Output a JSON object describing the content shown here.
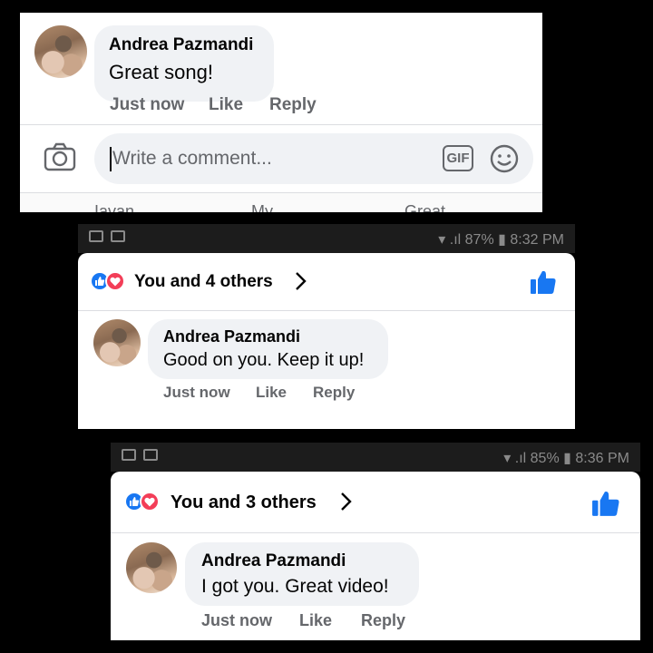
{
  "top": {
    "comment": {
      "author": "Andrea Pazmandi",
      "text": "Great song!",
      "actions": {
        "time": "Just now",
        "like": "Like",
        "reply": "Reply"
      }
    },
    "composer": {
      "placeholder": "Write a comment...",
      "gif_label": "GIF"
    },
    "bottom_tabs": [
      "Iavan",
      "My",
      "Great"
    ]
  },
  "middle": {
    "status": {
      "battery": "87%",
      "time": "8:32 PM"
    },
    "reactions_text": "You and 4 others",
    "comment": {
      "author": "Andrea Pazmandi",
      "text": "Good on you. Keep it up!",
      "actions": {
        "time": "Just now",
        "like": "Like",
        "reply": "Reply"
      }
    }
  },
  "bottom": {
    "status": {
      "battery": "85%",
      "time": "8:36 PM"
    },
    "reactions_text": "You and 3 others",
    "comment": {
      "author": "Andrea Pazmandi",
      "text": "I got you. Great video!",
      "actions": {
        "time": "Just now",
        "like": "Like",
        "reply": "Reply"
      }
    }
  },
  "colors": {
    "accent": "#1877f2",
    "love": "#f33e58",
    "bubble": "#f0f2f5",
    "meta": "#65676b"
  }
}
